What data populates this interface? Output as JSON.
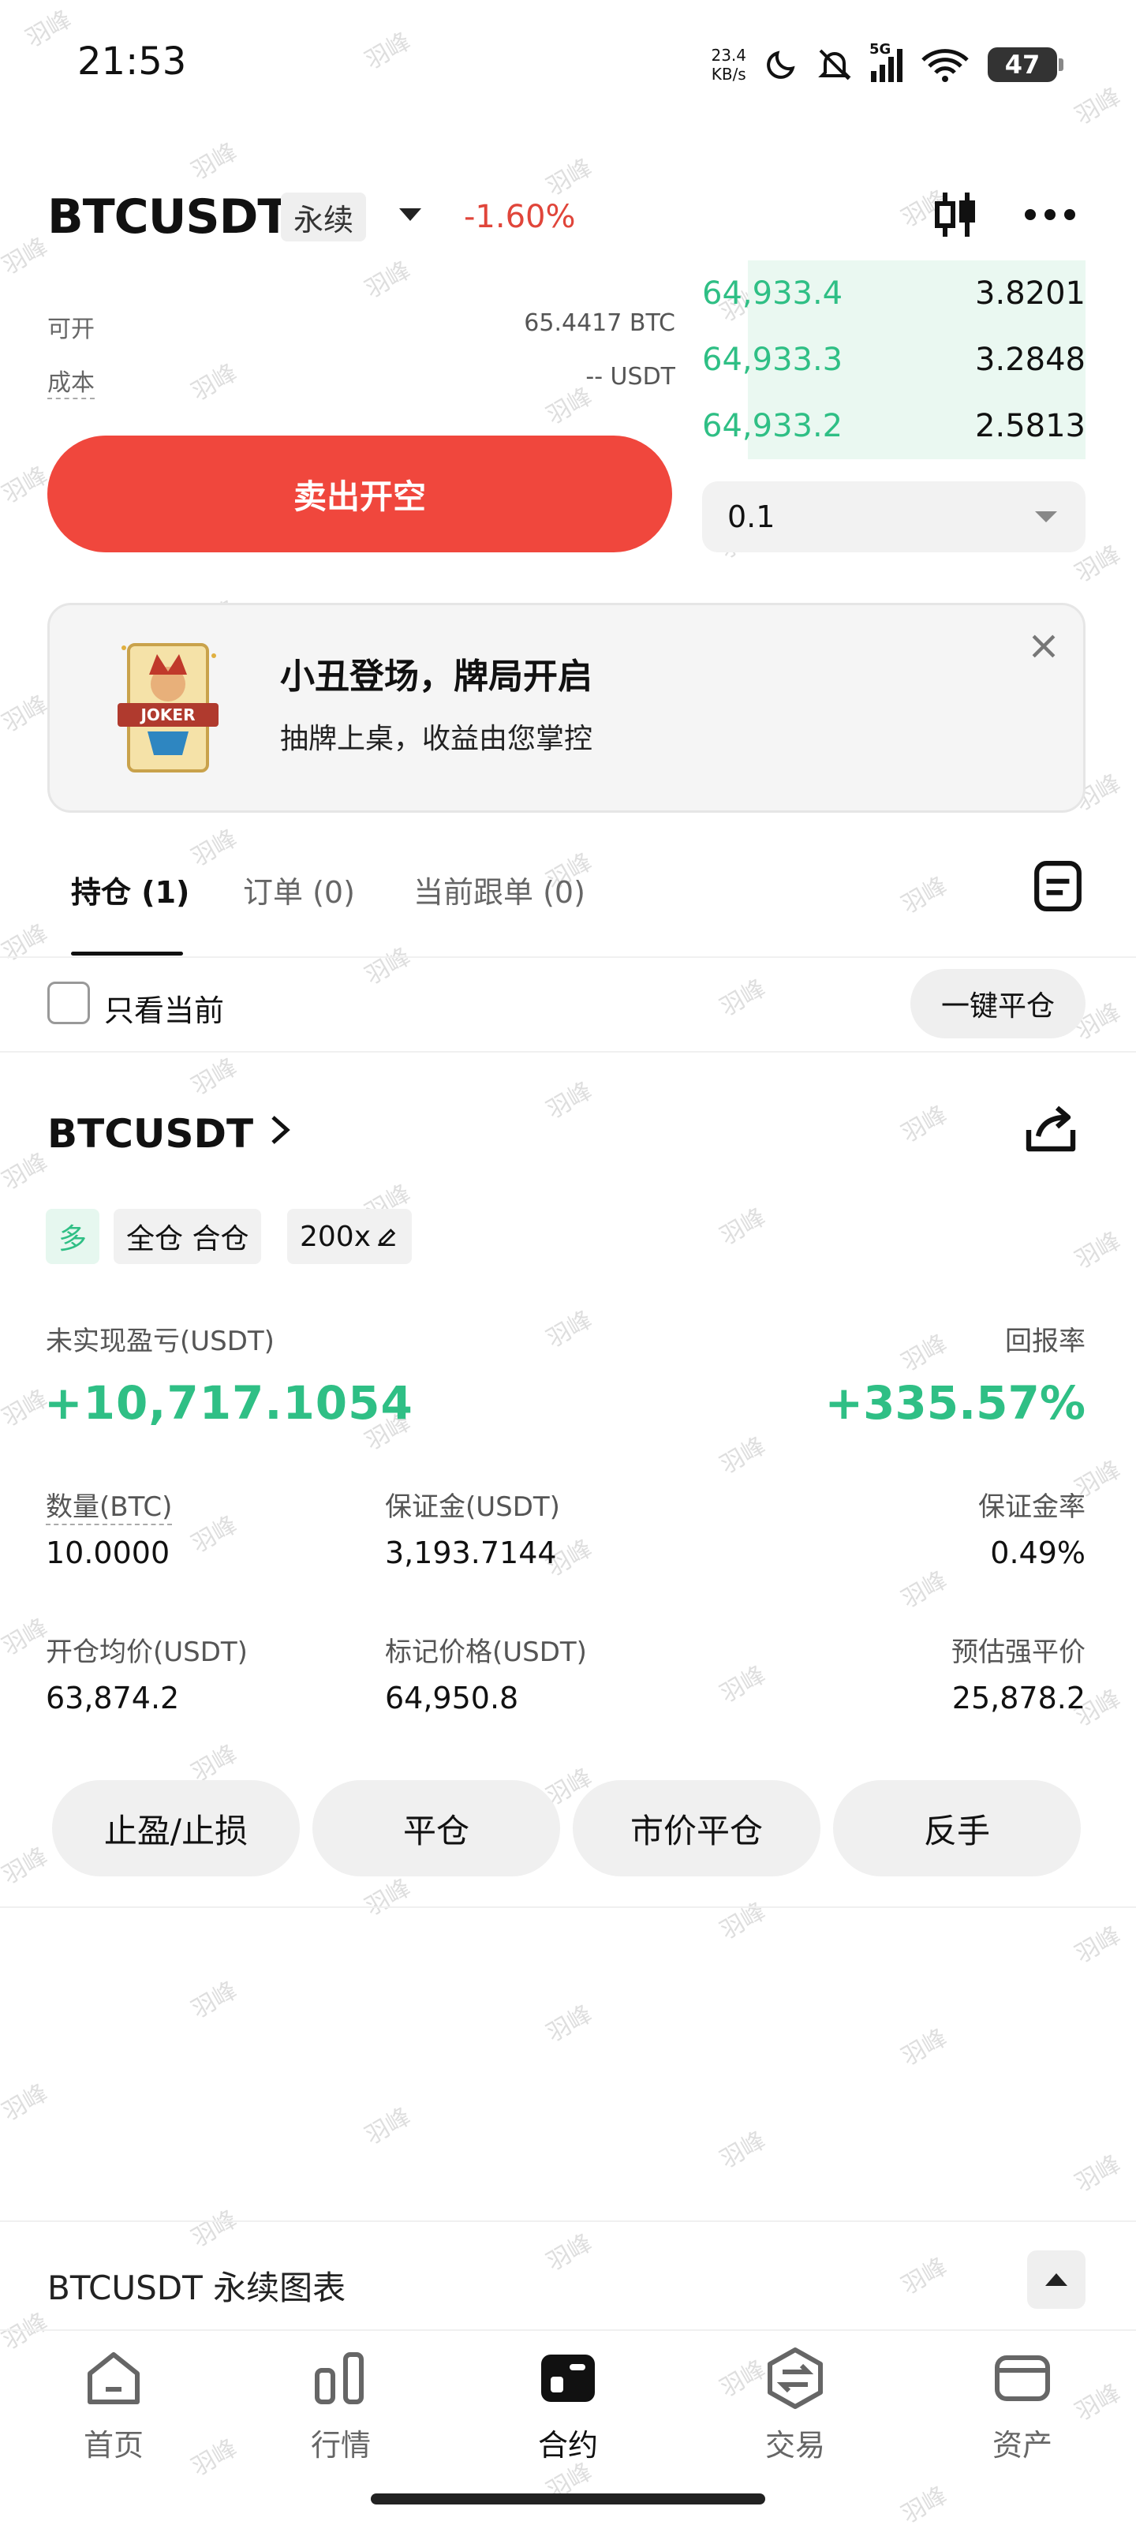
{
  "status_bar": {
    "time": "21:53",
    "net_speed_value": "23.4",
    "net_speed_unit": "KB/s",
    "network_type": "5G",
    "battery": "47"
  },
  "header": {
    "symbol": "BTCUSDT",
    "contract_type": "永续",
    "change_pct": "-1.60%"
  },
  "trade_panel": {
    "available_label": "可开",
    "available_value": "65.4417 BTC",
    "cost_label": "成本",
    "cost_value": "-- USDT",
    "sell_button": "卖出开空"
  },
  "order_book": {
    "rows": [
      {
        "price": "64,933.4",
        "qty": "3.8201",
        "depth": 0.9
      },
      {
        "price": "64,933.3",
        "qty": "3.2848",
        "depth": 0.9
      },
      {
        "price": "64,933.2",
        "qty": "2.5813",
        "depth": 0.9
      }
    ],
    "quantity_selector": "0.1"
  },
  "promo": {
    "art_text": "JOKER",
    "title": "小丑登场，牌局开启",
    "subtitle": "抽牌上桌，收益由您掌控"
  },
  "tabs": [
    {
      "label": "持仓 (1)"
    },
    {
      "label": "订单 (0)"
    },
    {
      "label": "当前跟单 (0)"
    }
  ],
  "filter": {
    "only_current_label": "只看当前",
    "close_all_button": "一键平仓"
  },
  "position": {
    "symbol": "BTCUSDT",
    "side_badge": "多",
    "margin_mode_badge": "全仓 合仓",
    "leverage_badge": "200x",
    "unrealized_pnl_label": "未实现盈亏(USDT)",
    "unrealized_pnl_value": "+10,717.1054",
    "roe_label": "回报率",
    "roe_value": "+335.57%",
    "qty_label": "数量(BTC)",
    "qty_value": "10.0000",
    "margin_label": "保证金(USDT)",
    "margin_value": "3,193.7144",
    "margin_ratio_label": "保证金率",
    "margin_ratio_value": "0.49%",
    "entry_label": "开仓均价(USDT)",
    "entry_value": "63,874.2",
    "mark_label": "标记价格(USDT)",
    "mark_value": "64,950.8",
    "liq_label": "预估强平价",
    "liq_value": "25,878.2",
    "actions": [
      "止盈/止损",
      "平仓",
      "市价平仓",
      "反手"
    ]
  },
  "chart_bar": {
    "title": "BTCUSDT 永续图表"
  },
  "bottom_nav": [
    {
      "label": "首页",
      "icon": "home-icon"
    },
    {
      "label": "行情",
      "icon": "market-icon"
    },
    {
      "label": "合约",
      "icon": "futures-icon"
    },
    {
      "label": "交易",
      "icon": "trade-icon"
    },
    {
      "label": "资产",
      "icon": "wallet-icon"
    }
  ],
  "watermark": "羽峰",
  "colors": {
    "up": "#2fbf85",
    "down": "#f0473d",
    "change_negative": "#e0453a"
  }
}
